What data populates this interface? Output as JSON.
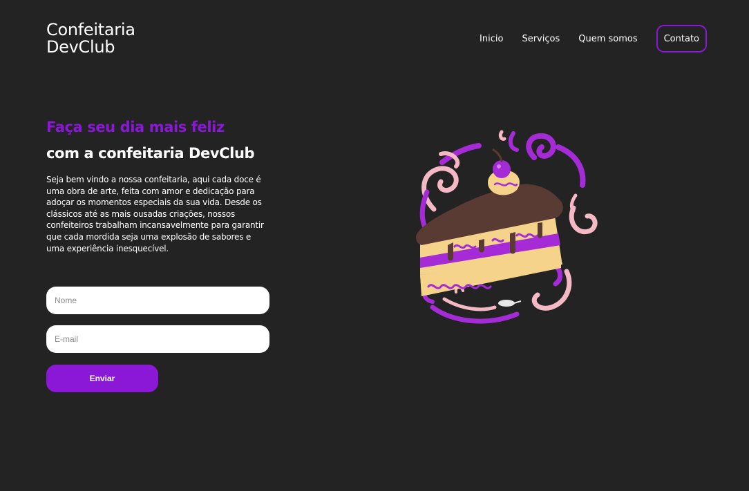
{
  "header": {
    "logo_line1": "Confeitaria",
    "logo_line2": "DevClub",
    "nav": {
      "inicio": "Inicio",
      "servicos": "Serviços",
      "quem_somos": "Quem somos",
      "contato": "Contato"
    }
  },
  "hero": {
    "title_highlight": "Faça seu dia mais feliz",
    "title_main": "com a confeitaria DevClub",
    "description": "Seja bem vindo a nossa confeitaria, aqui cada doce é uma obra de arte, feita com amor e dedicação para adoçar os momentos especiais da sua vida. Desde os clássicos até as mais ousadas criações, nossos confeiteiros trabalham incansavelmente para garantir que cada mordida seja uma explosão de sabores e uma experiência inesquecível."
  },
  "form": {
    "name_placeholder": "Nome",
    "email_placeholder": "E-mail",
    "submit_label": "Enviar"
  },
  "colors": {
    "background": "#232323",
    "accent": "#8a18d6",
    "text": "#ffffff"
  },
  "illustration": {
    "subject": "cake-slice-icon"
  }
}
